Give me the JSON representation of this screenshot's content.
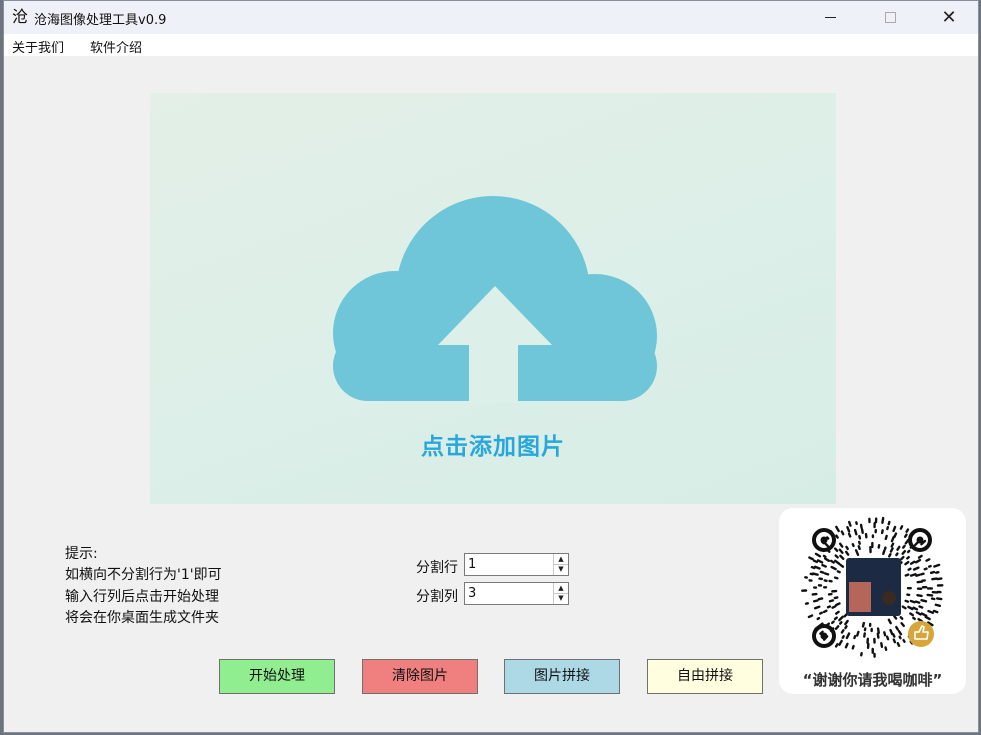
{
  "window": {
    "app_icon_glyph": "沧",
    "title": "沧海图像处理工具v0.9",
    "controls": {
      "minimize": "",
      "maximize": "",
      "close": "✕"
    }
  },
  "menu": {
    "items": [
      {
        "label": "关于我们"
      },
      {
        "label": "软件介绍"
      }
    ]
  },
  "upload": {
    "label": "点击添加图片",
    "icon": "cloud-upload-icon",
    "cloud_color": "#6ec6d8",
    "label_color": "#29a7dc"
  },
  "hints": [
    "提示:",
    "如横向不分割行为'1'即可",
    "输入行列后点击开始处理",
    "将会在你桌面生成文件夹"
  ],
  "fields": {
    "rows": {
      "label": "分割行",
      "value": "1"
    },
    "cols": {
      "label": "分割列",
      "value": "3"
    },
    "spin_up": "▲",
    "spin_down": "▼"
  },
  "buttons": {
    "start": {
      "label": "开始处理",
      "color": "#90ee90"
    },
    "clear": {
      "label": "清除图片",
      "color": "#f08080"
    },
    "stitch": {
      "label": "图片拼接",
      "color": "#add8e6"
    },
    "free_stitch": {
      "label": "自由拼接",
      "color": "#ffffe0"
    }
  },
  "donation": {
    "caption": "“谢谢你请我喝咖啡”",
    "qr_icon": "qr-code-icon",
    "badge_icon": "thumbs-up-icon",
    "badge_color": "#d7a63b"
  }
}
